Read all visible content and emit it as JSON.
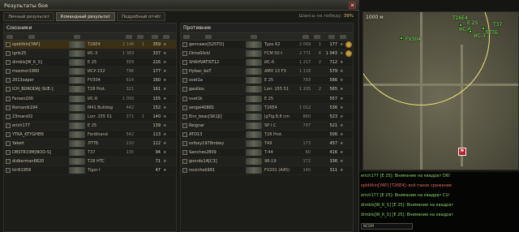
{
  "window": {
    "title": "Результаты боя",
    "close": "✕"
  },
  "tabs": [
    {
      "label": "Личный результат"
    },
    {
      "label": "Командный результат"
    },
    {
      "label": "Подробный отчёт"
    }
  ],
  "win_chance": {
    "label": "Шансы на победу:",
    "value": "39%"
  },
  "allies": {
    "title": "Союзники",
    "rows": [
      {
        "name": "spiditkin[YAP]",
        "tank": "T26E4",
        "n1": "2 146",
        "n2": "1",
        "n3": "359"
      },
      {
        "name": "Igrik25",
        "tank": "ИС-3",
        "n1": "1 383",
        "n2": "",
        "n3": "337"
      },
      {
        "name": "dimbls[W_K_S]",
        "tank": "E 25",
        "n1": "359",
        "n2": "",
        "n3": "226"
      },
      {
        "name": "mozmor1990",
        "tank": "ИСУ-152",
        "n1": "796",
        "n2": "",
        "n3": "177"
      },
      {
        "name": "2013ozper",
        "tank": "FV304",
        "n1": "614",
        "n2": "",
        "n3": "160"
      },
      {
        "name": "ICH_BORODA[-SUE-]",
        "tank": "T28 Prot.",
        "n1": "321",
        "n2": "",
        "n3": "161"
      },
      {
        "name": "Farsen200",
        "tank": "ИС-6",
        "n1": "1 050",
        "n2": "",
        "n3": "155"
      },
      {
        "name": "Romanik194",
        "tank": "M41 Bulldog",
        "n1": "442",
        "n2": "",
        "n3": "152"
      },
      {
        "name": "23mars02",
        "tank": "Lorr. 155 51",
        "n1": "371",
        "n2": "1",
        "n3": "140"
      },
      {
        "name": "erich177",
        "tank": "E 25",
        "n1": "",
        "n2": "",
        "n3": "139"
      },
      {
        "name": "YTKA_KTYGHEN",
        "tank": "Ferdinand",
        "n1": "542",
        "n2": "",
        "n3": "113"
      },
      {
        "name": "Yakelt",
        "tank": "ЛТТБ",
        "n1": "210",
        "n2": "",
        "n3": "112"
      },
      {
        "name": "DBSTR33M[NOD-S]",
        "tank": "T37",
        "n1": "135",
        "n2": "",
        "n3": "94"
      },
      {
        "name": "didkerman6820",
        "tank": "T28 HTC",
        "n1": "",
        "n2": "",
        "n3": "71"
      },
      {
        "name": "kirill1959",
        "tank": "Tiger I",
        "n1": "",
        "n2": "",
        "n3": "47"
      }
    ]
  },
  "enemies": {
    "title": "Противник",
    "rows": [
      {
        "name": "gennawx[S25TD]",
        "tank": "Type 62",
        "n1": "2 069",
        "n2": "1",
        "n3": "177"
      },
      {
        "name": "DimaSlickl",
        "tank": "FCM 50 t",
        "n1": "2 771",
        "n2": "6",
        "n3": "1 043"
      },
      {
        "name": "SHAHVATIST12",
        "tank": "ИС-6",
        "n1": "1 217",
        "n2": "2",
        "n3": "712"
      },
      {
        "name": "Hybac_boT",
        "tank": "AMX 13 F3",
        "n1": "1 118",
        "n2": "",
        "n3": "579"
      },
      {
        "name": "svet1a",
        "tank": "E 25",
        "n1": "793",
        "n2": "",
        "n3": "566"
      },
      {
        "name": "gasilios",
        "tank": "Lorr. 155 51",
        "n1": "1 205",
        "n2": "2",
        "n3": "565"
      },
      {
        "name": "svet1k",
        "tank": "E 25",
        "n1": "",
        "n2": "",
        "n3": "557"
      },
      {
        "name": "sergei40881",
        "tank": "T26E4",
        "n1": "1 012",
        "n2": "",
        "n3": "536"
      },
      {
        "name": "Enn_beac[SK1JI]",
        "tank": "JgTig.8,8 cm",
        "n1": "860",
        "n2": "",
        "n3": "523"
      },
      {
        "name": "Reignar",
        "tank": "SP I C",
        "n1": "797",
        "n2": "",
        "n3": "521"
      },
      {
        "name": "ATO13",
        "tank": "T28 Prot.",
        "n1": "",
        "n2": "",
        "n3": "506"
      },
      {
        "name": "svfoxy1978rnbey",
        "tank": "T49",
        "n1": "173",
        "n2": "",
        "n3": "457"
      },
      {
        "name": "Sanches2809",
        "tank": "T-44",
        "n1": "60",
        "n2": "",
        "n3": "416"
      },
      {
        "name": "gonrdo14[C3]",
        "tank": "98-19",
        "n1": "172",
        "n2": "",
        "n3": "336"
      },
      {
        "name": "novichek991",
        "tank": "FV201 (A45)",
        "n1": "140",
        "n2": "",
        "n3": "311"
      }
    ]
  },
  "map": {
    "scale": "1000 м",
    "markers": [
      "E 25",
      "ЛТТБ",
      "FV304",
      "T26E4",
      "ИС-3",
      "ИС-6",
      "T37"
    ]
  },
  "chat": [
    {
      "text": "erich177 [E 25]: Внимание на квадрат D6!"
    },
    {
      "text": "spiditkin[YAP] [T26E4]: всё-такое сражение"
    },
    {
      "text": "erich177 [E 25]: Внимание на квадрат C1!"
    },
    {
      "text": "dimbls[W_K_S] [E 25]: Внимание на квадрат"
    },
    {
      "text": "dimbls[W_K_S] [E 25]: Внимание на квадрат"
    }
  ],
  "chat_input": "ВСЕМ"
}
